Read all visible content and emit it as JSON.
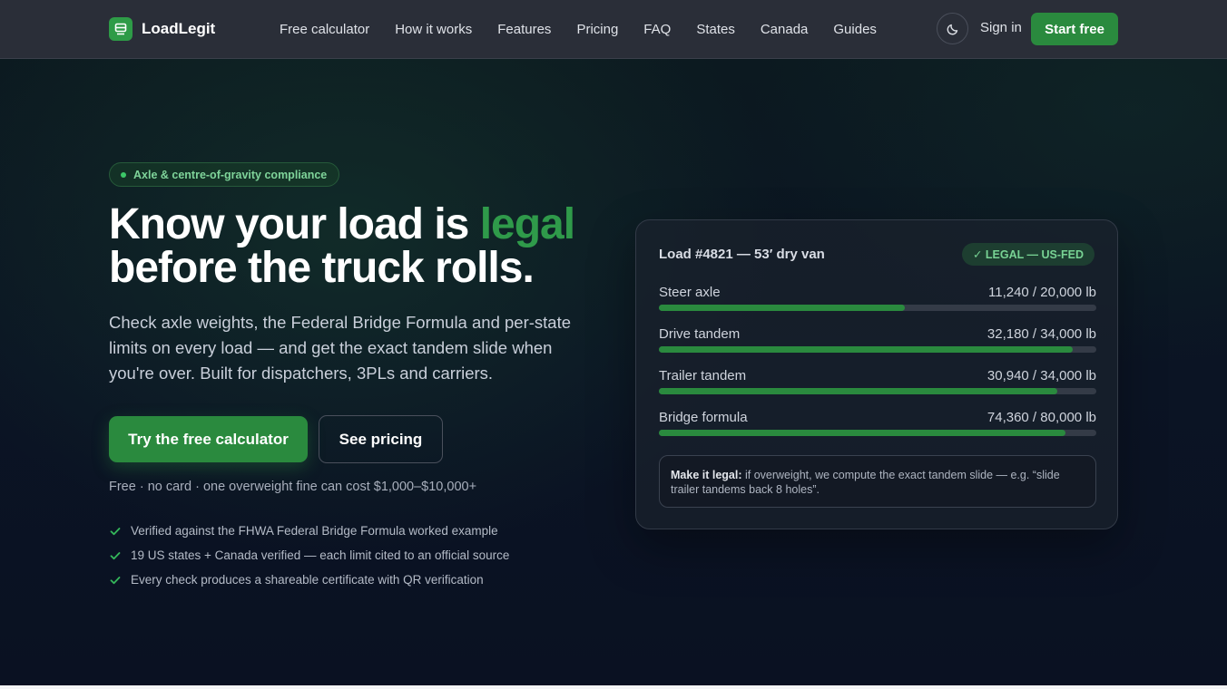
{
  "brand": {
    "name": "LoadLegit",
    "accent": "#2a8a3e"
  },
  "nav": {
    "items": [
      "Free calculator",
      "How it works",
      "Features",
      "Pricing",
      "FAQ",
      "States",
      "Canada",
      "Guides"
    ],
    "theme_icon": "moon-icon",
    "sign_in": "Sign in",
    "start": "Start free"
  },
  "hero": {
    "pill": "Axle & centre-of-gravity compliance",
    "headline_pre": "Know your load is ",
    "headline_accent": "legal",
    "headline_post": "before the truck rolls.",
    "subtitle": "Check axle weights, the Federal Bridge Formula and per-state limits on every load — and get the exact tandem slide when you're over. Built for dispatchers, 3PLs and carriers.",
    "cta_primary": "Try the free calculator",
    "cta_secondary": "See pricing",
    "fine_print": "Free · no card · one overweight fine can cost $1,000–$10,000+",
    "checks": [
      "Verified against the FHWA Federal Bridge Formula worked example",
      "19 US states + Canada verified — each limit cited to an official source",
      "Every check produces a shareable certificate with QR verification"
    ]
  },
  "card": {
    "title": "Load #4821 — 53′ dry van",
    "badge": "✓ LEGAL — US-FED",
    "metrics": [
      {
        "label": "Steer axle",
        "value": "11,240 / 20,000 lb",
        "fill": 0.562
      },
      {
        "label": "Drive tandem",
        "value": "32,180 / 34,000 lb",
        "fill": 0.946
      },
      {
        "label": "Trailer tandem",
        "value": "30,940 / 34,000 lb",
        "fill": 0.91
      },
      {
        "label": "Bridge formula",
        "value": "74,360 / 80,000 lb",
        "fill": 0.93
      }
    ],
    "note_bold": "Make it legal:",
    "note_text": " if overweight, we compute the exact tandem slide — e.g. “slide trailer tandems back 8 holes”."
  }
}
